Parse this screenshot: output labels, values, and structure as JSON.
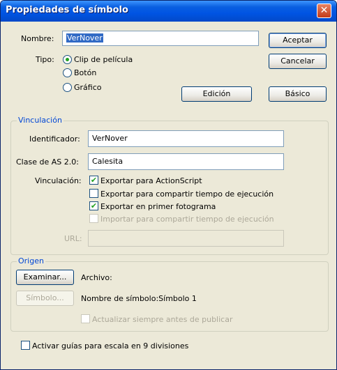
{
  "window": {
    "title": "Propiedades de símbolo",
    "close_glyph": "✕"
  },
  "nombre": {
    "label": "Nombre:",
    "value": "VerNover"
  },
  "tipo": {
    "label": "Tipo:",
    "options": [
      "Clip de película",
      "Botón",
      "Gráfico"
    ],
    "selected": "Clip de película"
  },
  "buttons": {
    "aceptar": "Aceptar",
    "cancelar": "Cancelar",
    "edicion": "Edición",
    "basico": "Básico"
  },
  "vinculacion": {
    "title": "Vinculación",
    "identificador_label": "Identificador:",
    "identificador_value": "VerNover",
    "clase_label": "Clase de AS 2.0:",
    "clase_value": "Calesita",
    "vinc_label": "Vinculación:",
    "checks": [
      {
        "label": "Exportar para ActionScript",
        "checked": true,
        "enabled": true
      },
      {
        "label": "Exportar para compartir tiempo de ejecución",
        "checked": false,
        "enabled": true
      },
      {
        "label": "Exportar en primer fotograma",
        "checked": true,
        "enabled": true
      },
      {
        "label": "Importar para compartir tiempo de ejecución",
        "checked": false,
        "enabled": false
      }
    ],
    "url_label": "URL:",
    "url_value": ""
  },
  "origen": {
    "title": "Origen",
    "examinar": "Examinar...",
    "archivo_label": "Archivo:",
    "simbolo_button": "Símbolo...",
    "nombre_simbolo": "Nombre de símbolo:Símbolo 1",
    "actualizar": "Actualizar siempre antes de publicar"
  },
  "guias": {
    "label": "Activar guías para escala en 9 divisiones",
    "checked": false
  },
  "colors": {
    "accent": "#0046d5",
    "check": "#21a121",
    "titlebar": "#0054e3"
  }
}
